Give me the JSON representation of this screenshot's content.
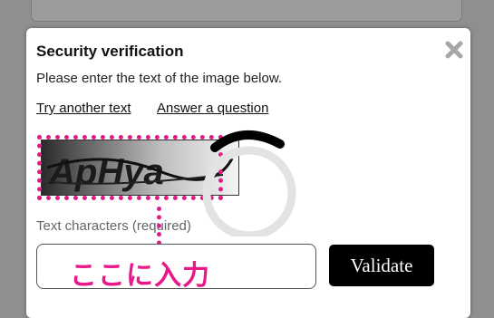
{
  "dialog": {
    "title": "Security verification",
    "description": "Please enter the text of the image below.",
    "close_icon": "close-icon"
  },
  "links": {
    "try_another": "Try another text",
    "answer_question": "Answer a question"
  },
  "captcha": {
    "text": "ApHya"
  },
  "field": {
    "label": "Text characters (required)",
    "value": "",
    "placeholder": ""
  },
  "annotation": {
    "callout_text": "ここに入力"
  },
  "buttons": {
    "validate": "Validate"
  },
  "colors": {
    "accent": "#e8178a",
    "button_bg": "#000000",
    "overlay": "#8f8f8f"
  }
}
